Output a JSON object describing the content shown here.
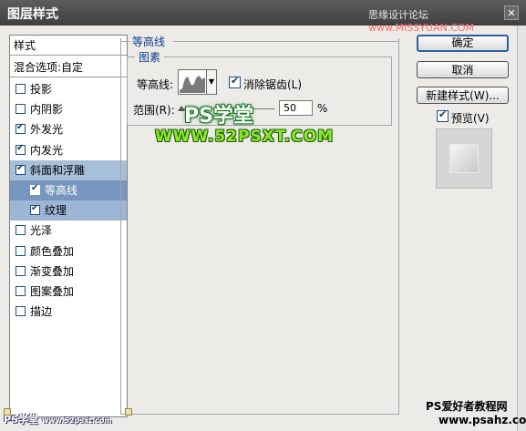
{
  "window": {
    "title": "图层样式",
    "watermark_top_prefix": "思缘设计论坛 ",
    "watermark_top_site": "www.MISSYUAN.COM"
  },
  "styles_panel": {
    "header": "样式",
    "blend_options": "混合选项:自定",
    "items": [
      {
        "label": "投影",
        "checked": false
      },
      {
        "label": "内阴影",
        "checked": false
      },
      {
        "label": "外发光",
        "checked": true
      },
      {
        "label": "内发光",
        "checked": true
      },
      {
        "label": "斜面和浮雕",
        "checked": true
      },
      {
        "label": "等高线",
        "checked": true
      },
      {
        "label": "纹理",
        "checked": true
      },
      {
        "label": "光泽",
        "checked": false
      },
      {
        "label": "颜色叠加",
        "checked": false
      },
      {
        "label": "渐变叠加",
        "checked": false
      },
      {
        "label": "图案叠加",
        "checked": false
      },
      {
        "label": "描边",
        "checked": false
      }
    ]
  },
  "contour_section": {
    "group_title": "等高线",
    "subgroup_title": "图素",
    "contour_label": "等高线:",
    "antialias_label": "消除锯齿(L)",
    "antialias_checked": true,
    "range_label": "范围(R):",
    "range_value": "50",
    "range_unit": "%",
    "range_slider_fraction": 0.02
  },
  "buttons": {
    "ok": "确定",
    "cancel": "取消",
    "new_style": "新建样式(W)...",
    "preview_label": "预览(V)",
    "preview_checked": true
  },
  "watermarks": {
    "ps_logo": "PS学堂",
    "site_url": "WWW.52PSXT.COM",
    "bottom_left": "PS学堂",
    "bottom_left_small": "www.52psxt.com",
    "bottom_right_1": "PS爱好者教程网",
    "bottom_right_2": "www.psahz.com"
  },
  "colors": {
    "selected_row": "#a8bfda",
    "sub_row": "#9eb6d6",
    "sub_row_selected": "#7696bf",
    "group_title": "#0a3c8c"
  }
}
